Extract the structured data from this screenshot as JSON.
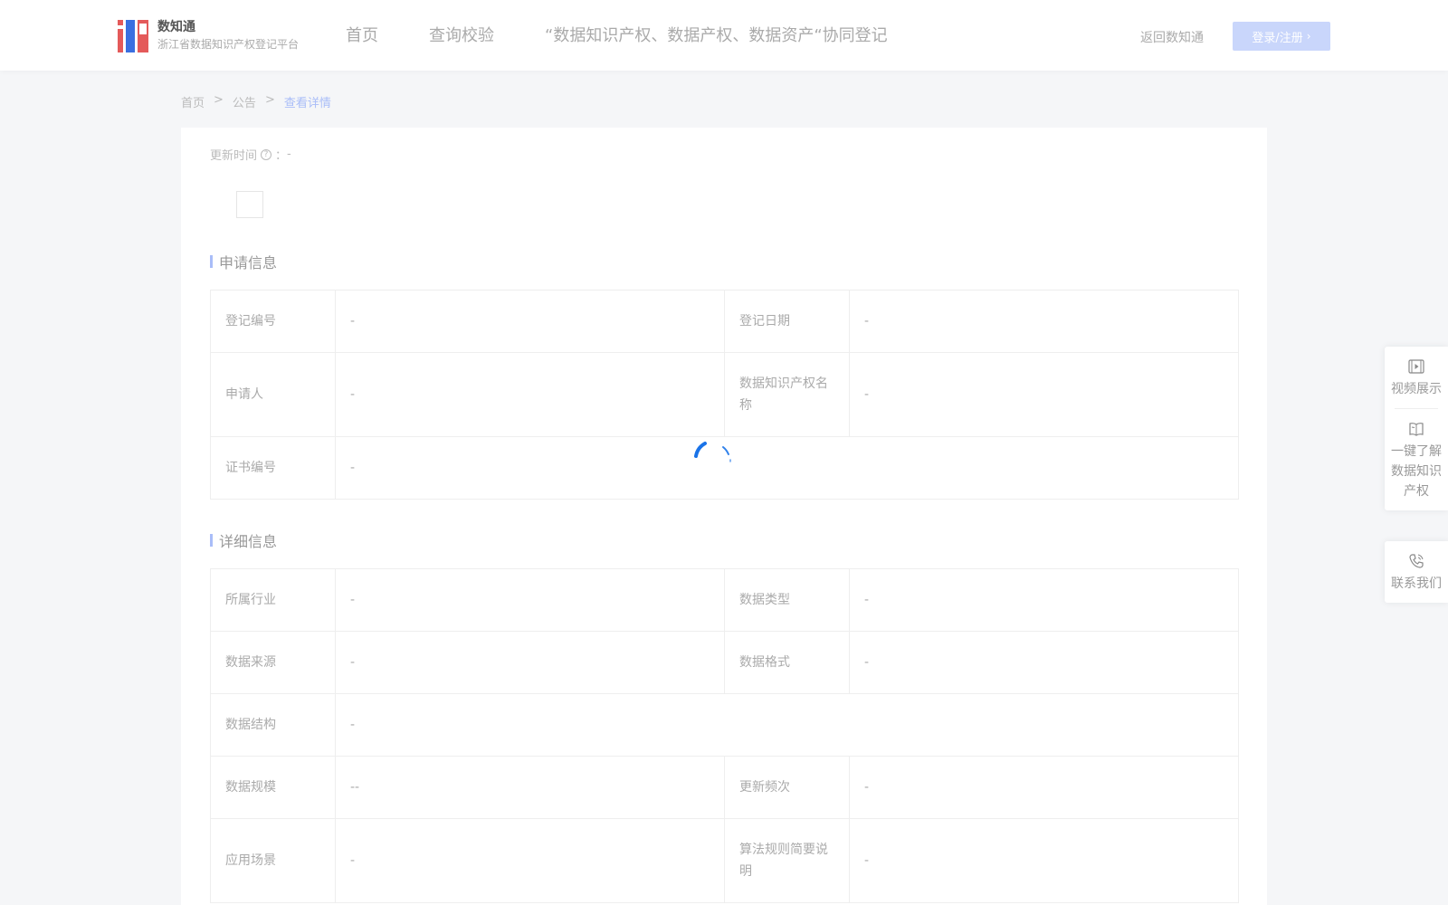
{
  "header": {
    "logo_title": "数知通",
    "logo_subtitle": "浙江省数据知识产权登记平台",
    "nav": [
      "首页",
      "查询校验",
      "“数据知识产权、数据产权、数据资产“协同登记"
    ],
    "back_link": "返回数知通",
    "login_button": "登录/注册"
  },
  "breadcrumb": {
    "items": [
      "首页",
      "公告",
      "查看详情"
    ],
    "separator": ">"
  },
  "update": {
    "label": "更新时间",
    "colon": "：",
    "value": "-"
  },
  "apply_section": {
    "title": "申请信息",
    "rows": [
      {
        "l1": "登记编号",
        "v1": "-",
        "l2": "登记日期",
        "v2": "-"
      },
      {
        "l1": "申请人",
        "v1": "-",
        "l2": "数据知识产权名称",
        "v2": "-"
      },
      {
        "l1": "证书编号",
        "v1": "-"
      }
    ]
  },
  "detail_section": {
    "title": "详细信息",
    "rows": [
      {
        "l1": "所属行业",
        "v1": "-",
        "l2": "数据类型",
        "v2": "-"
      },
      {
        "l1": "数据来源",
        "v1": "-",
        "l2": "数据格式",
        "v2": "-"
      },
      {
        "l1": "数据结构",
        "v1": "-"
      },
      {
        "l1": "数据规模",
        "v1": "--",
        "l2": "更新频次",
        "v2": "-"
      },
      {
        "l1": "应用场景",
        "v1": "-",
        "l2": "算法规则简要说明",
        "v2": "-"
      }
    ]
  },
  "float_panel": {
    "video": "视频展示",
    "learn": "一键了解数据知识产权",
    "contact": "联系我们"
  },
  "colors": {
    "accent": "#1a73e8",
    "accent_light": "#a9bdf8",
    "login_bg": "#c9d6fb",
    "logo_red": "#e45a5a",
    "logo_blue": "#3a6fe0"
  },
  "icons": [
    "question-circle-icon",
    "video-icon",
    "book-icon",
    "phone-icon",
    "chevron-right-icon",
    "loading-spinner-icon"
  ]
}
